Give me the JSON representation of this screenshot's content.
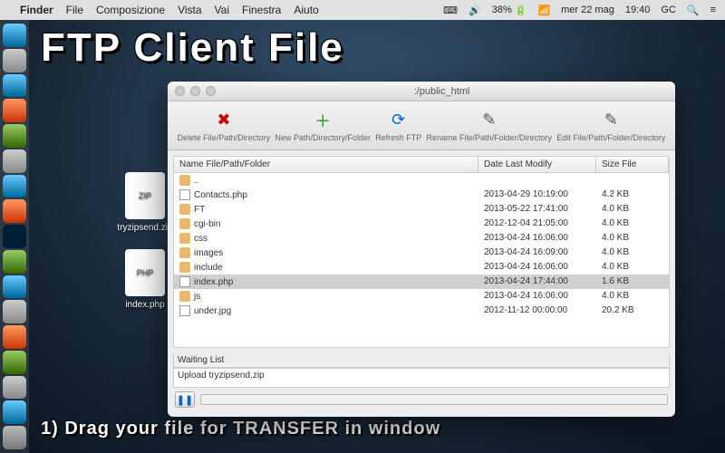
{
  "menubar": {
    "app": "Finder",
    "items": [
      "File",
      "Composizione",
      "Vista",
      "Vai",
      "Finestra",
      "Aiuto"
    ],
    "battery": "38%",
    "date": "mer 22 mag",
    "time": "19:40",
    "user": "GC"
  },
  "desktop": {
    "zip_label": "tryzipsend.zip",
    "zip_badge": "ZIP",
    "php_label": "index.php",
    "php_badge": "PHP"
  },
  "overlay": {
    "title": "FTP Client File",
    "instruction": "1) Drag your file for TRANSFER in window"
  },
  "window": {
    "title": ":/public_html",
    "toolbar": {
      "delete": "Delete File/Path/Directory",
      "new": "New Path/Directory/Folder",
      "refresh": "Refresh FTP",
      "rename": "Rename File/Path/Folder/Directory",
      "edit": "Edit File/Path/Folder/Directory"
    },
    "columns": {
      "name": "Name File/Path/Folder",
      "date": "Date Last Modify",
      "size": "Size File"
    },
    "rows": [
      {
        "icon": "folder",
        "name": "..",
        "date": "",
        "size": "",
        "sel": false
      },
      {
        "icon": "file",
        "name": "Contacts.php",
        "date": "2013-04-29 10:19:00",
        "size": "4.2 KB",
        "sel": false
      },
      {
        "icon": "folder",
        "name": "FT",
        "date": "2013-05-22 17:41:00",
        "size": "4.0 KB",
        "sel": false
      },
      {
        "icon": "folder",
        "name": "cgi-bin",
        "date": "2012-12-04 21:05:00",
        "size": "4.0 KB",
        "sel": false
      },
      {
        "icon": "folder",
        "name": "css",
        "date": "2013-04-24 16:06:00",
        "size": "4.0 KB",
        "sel": false
      },
      {
        "icon": "folder",
        "name": "images",
        "date": "2013-04-24 16:09:00",
        "size": "4.0 KB",
        "sel": false
      },
      {
        "icon": "folder",
        "name": "include",
        "date": "2013-04-24 16:06:00",
        "size": "4.0 KB",
        "sel": false
      },
      {
        "icon": "file",
        "name": "index.php",
        "date": "2013-04-24 17:44:00",
        "size": "1.6 KB",
        "sel": true
      },
      {
        "icon": "folder",
        "name": "js",
        "date": "2013-04-24 16:06:00",
        "size": "4.0 KB",
        "sel": false
      },
      {
        "icon": "file",
        "name": "under.jpg",
        "date": "2012-11-12 00:00:00",
        "size": "20.2 KB",
        "sel": false
      }
    ],
    "waiting_label": "Waiting List",
    "waiting_item": "Upload tryzipsend.zip"
  }
}
